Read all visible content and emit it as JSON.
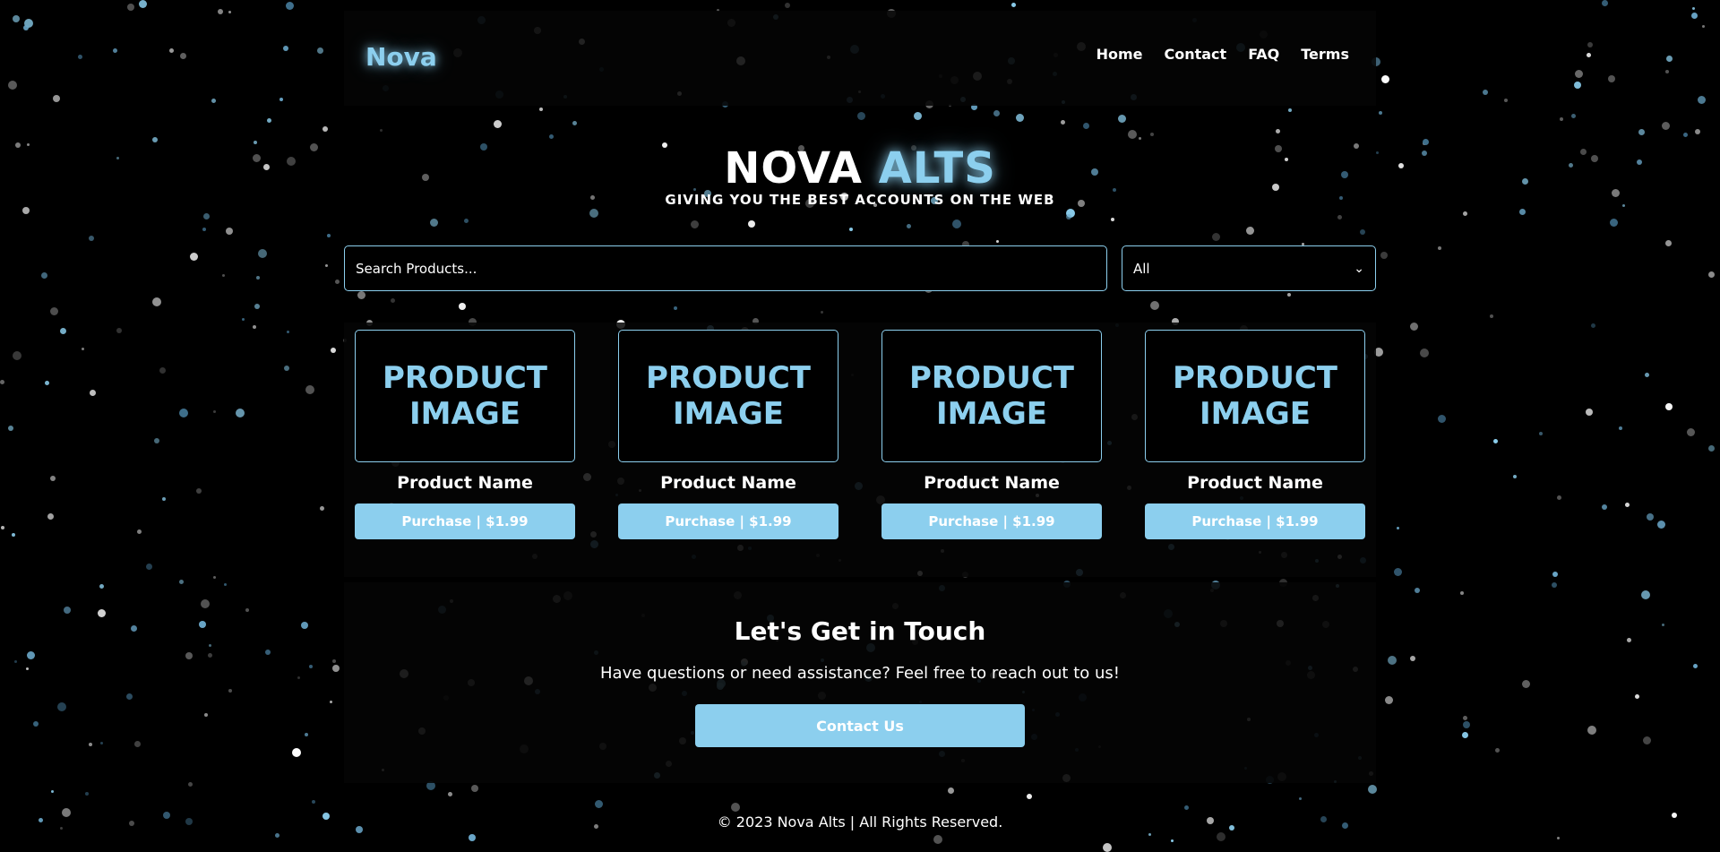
{
  "brand": {
    "logo": "Nova"
  },
  "nav": {
    "items": [
      "Home",
      "Contact",
      "FAQ",
      "Terms"
    ]
  },
  "hero": {
    "title_part1": "NOVA",
    "title_part2": "ALTS",
    "subtitle": "GIVING YOU THE BEST ACCOUNTS ON THE WEB"
  },
  "search": {
    "placeholder": "Search Products...",
    "filter_selected": "All"
  },
  "products": [
    {
      "image_text": "PRODUCT IMAGE",
      "name": "Product Name",
      "button": "Purchase | $1.99"
    },
    {
      "image_text": "PRODUCT IMAGE",
      "name": "Product Name",
      "button": "Purchase | $1.99"
    },
    {
      "image_text": "PRODUCT IMAGE",
      "name": "Product Name",
      "button": "Purchase | $1.99"
    },
    {
      "image_text": "PRODUCT IMAGE",
      "name": "Product Name",
      "button": "Purchase | $1.99"
    }
  ],
  "contact": {
    "title": "Let's Get in Touch",
    "text": "Have questions or need assistance? Feel free to reach out to us!",
    "button": "Contact Us"
  },
  "footer": {
    "text": "© 2023 Nova Alts | All Rights Reserved."
  },
  "colors": {
    "accent": "#8ccfee",
    "background": "#000000",
    "text": "#ffffff"
  }
}
